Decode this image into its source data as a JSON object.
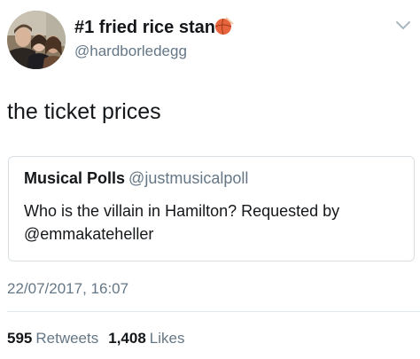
{
  "author": {
    "display_name": "#1 fried rice stan",
    "handle": "@hardborledegg",
    "name_emoji": "basketball-icon"
  },
  "tweet": {
    "text": "the ticket prices",
    "timestamp": "22/07/2017, 16:07"
  },
  "quoted_tweet": {
    "display_name": "Musical Polls",
    "handle": "@justmusicalpoll",
    "text": "Who is the villain in Hamilton? Requested by @emmakateheller"
  },
  "stats": {
    "retweets_count": "595",
    "retweets_label": "Retweets",
    "likes_count": "1,408",
    "likes_label": "Likes"
  },
  "colors": {
    "text_primary": "#14171a",
    "text_secondary": "#657786",
    "border": "#dadfe3",
    "emoji_accent": "#e8643c"
  },
  "icons": {
    "menu": "chevron-down-icon",
    "avatar": "profile-photo"
  }
}
